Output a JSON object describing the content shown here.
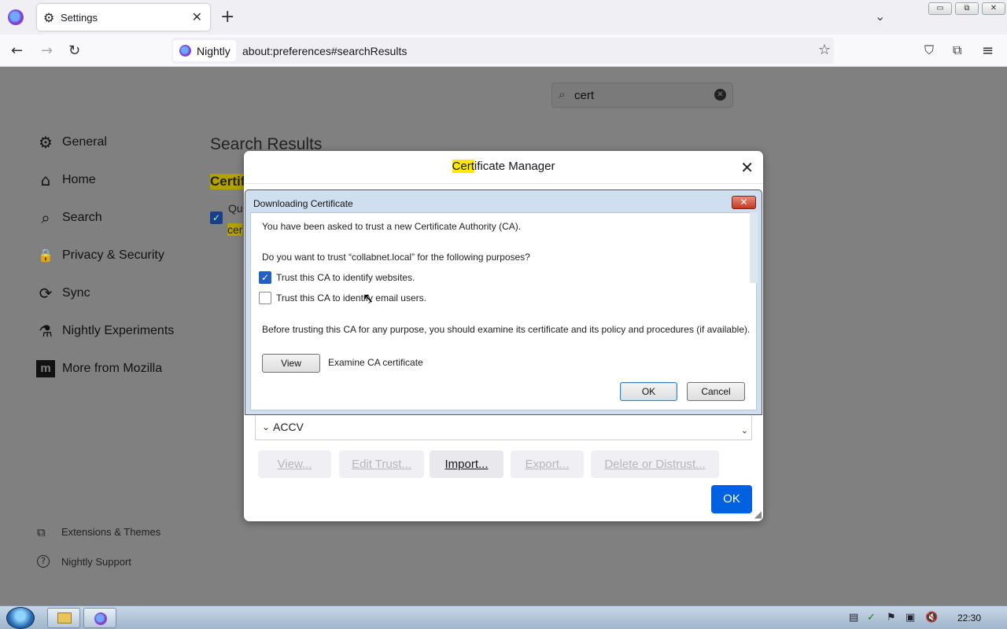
{
  "browser": {
    "tab_title": "Settings",
    "tab_close": "✕",
    "new_tab": "+",
    "tab_list": "⌄",
    "window_controls": {
      "minimize": "▭",
      "restore": "⧉",
      "close": "✕"
    },
    "nav": {
      "back": "←",
      "forward": "→",
      "reload": "↻"
    },
    "identity_label": "Nightly",
    "url": "about:preferences#searchResults",
    "toolbar_icons": {
      "bookmark": "☆",
      "pocket": "⛉",
      "extensions": "⧉",
      "menu": "≡"
    }
  },
  "preferences": {
    "search_value": "cert",
    "search_clear": "✕",
    "categories": [
      {
        "label": "General",
        "icon": "gear-icon",
        "glyph": "⚙"
      },
      {
        "label": "Home",
        "icon": "home-icon",
        "glyph": "⌂"
      },
      {
        "label": "Search",
        "icon": "search-icon",
        "glyph": "⌕"
      },
      {
        "label": "Privacy & Security",
        "icon": "lock-icon",
        "glyph": "🔒"
      },
      {
        "label": "Sync",
        "icon": "sync-icon",
        "glyph": "⟳"
      },
      {
        "label": "Nightly Experiments",
        "icon": "flask-icon",
        "glyph": "⚗"
      },
      {
        "label": "More from Mozilla",
        "icon": "mozilla-icon",
        "glyph": "m"
      }
    ],
    "footer": [
      {
        "label": "Extensions & Themes",
        "icon": "puzzle-icon",
        "glyph": "⧉"
      },
      {
        "label": "Nightly Support",
        "icon": "help-icon",
        "glyph": "?"
      }
    ],
    "results_heading": "Search Results",
    "group_title_partial": "Certif",
    "query_text_partial": "Qu",
    "query_cert_partial": "cer"
  },
  "cert_manager": {
    "title_highlight": "Cert",
    "title_rest": "ificate Manager",
    "close": "✕",
    "ca_name": "ACCV",
    "buttons": {
      "view": "View...",
      "edit_trust": "Edit Trust...",
      "import": "Import...",
      "export": "Export...",
      "delete": "Delete or Distrust..."
    },
    "ok": "OK"
  },
  "download_dialog": {
    "title": "Downloading Certificate",
    "close": "✕",
    "intro": "You have been asked to trust a new Certificate Authority (CA).",
    "question": "Do you want to trust “collabnet.local” for the following purposes?",
    "options": [
      {
        "label": "Trust this CA to identify websites.",
        "checked": true
      },
      {
        "label": "Trust this CA to identify email users.",
        "checked": false
      }
    ],
    "advice": "Before trusting this CA for any purpose, you should examine its certificate and its policy and procedures (if available).",
    "view_button": "View",
    "view_caption": "Examine CA certificate",
    "ok": "OK",
    "cancel": "Cancel"
  },
  "taskbar": {
    "time": "22:30"
  }
}
